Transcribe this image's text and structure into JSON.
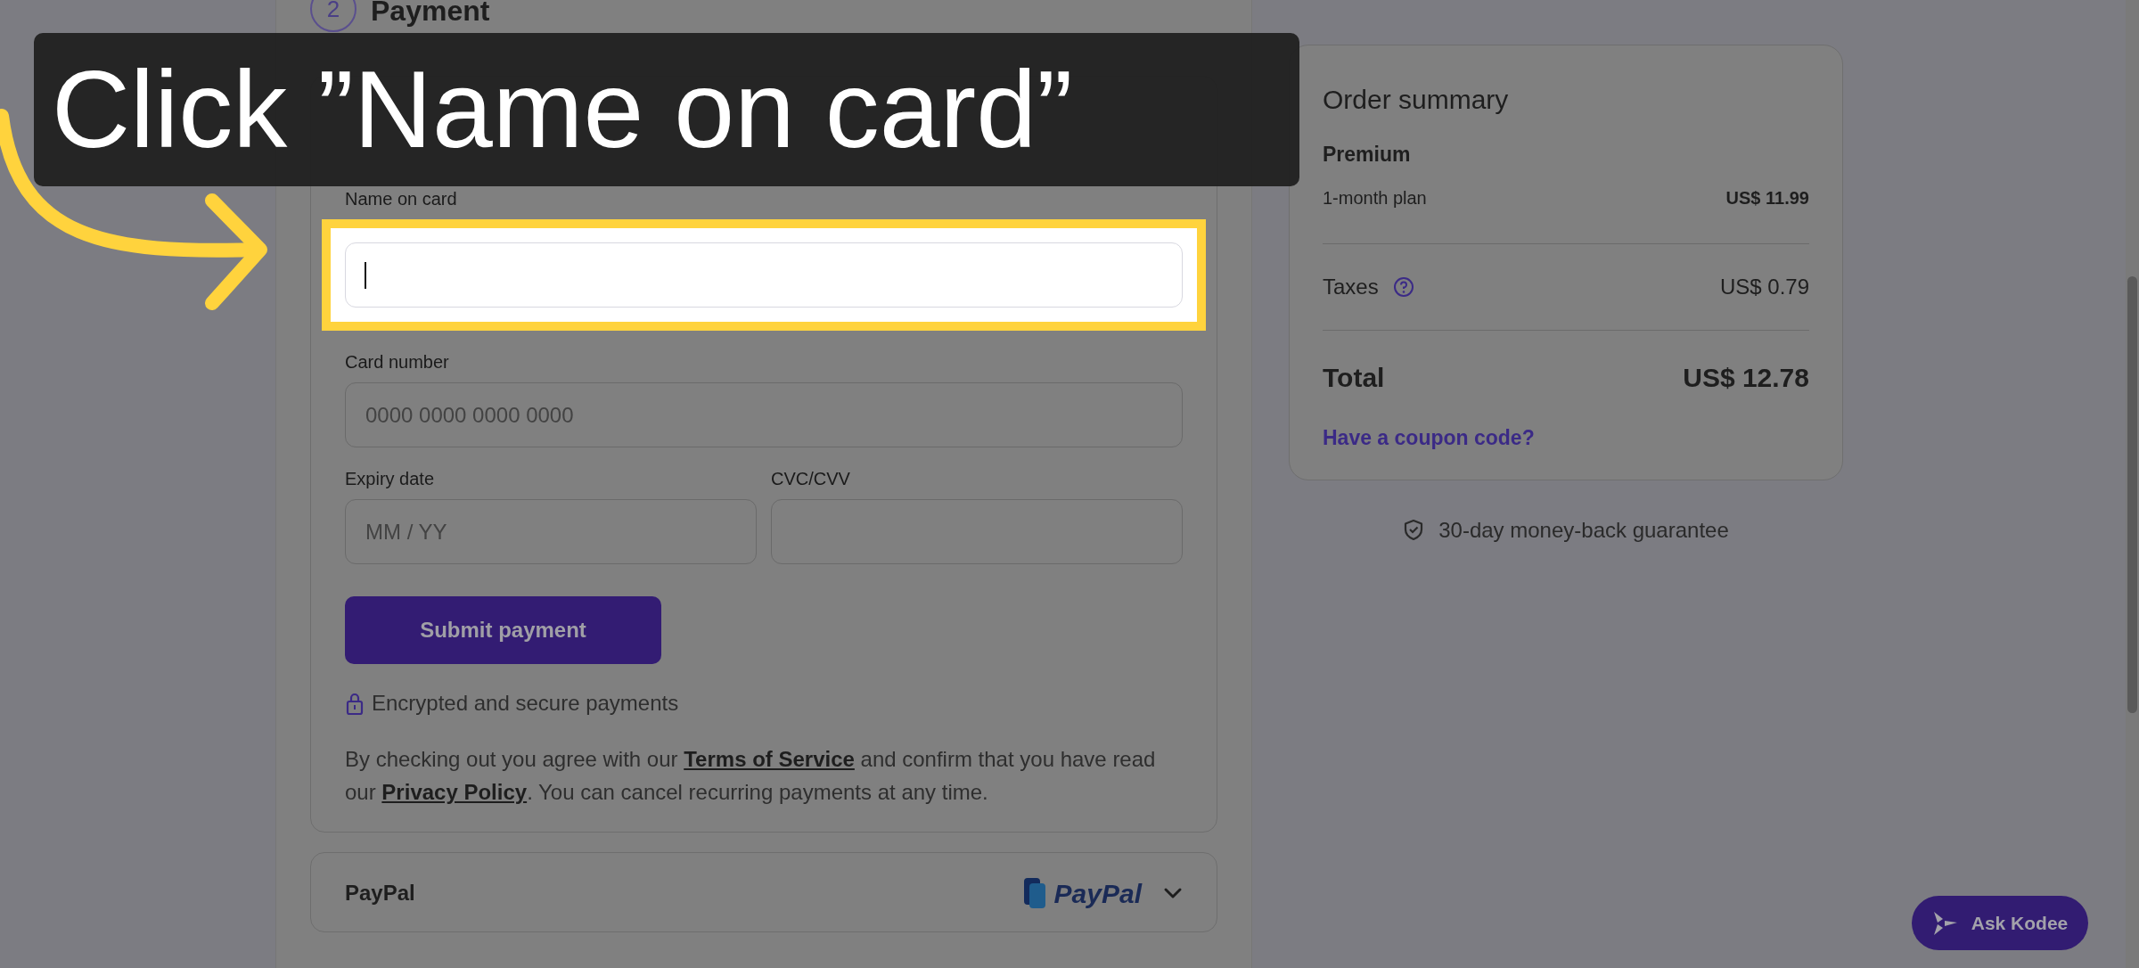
{
  "tutorial": {
    "callout": "Click ”Name on card”"
  },
  "step": {
    "number": "2",
    "title": "Payment"
  },
  "payment_methods": [
    {
      "kind": "card",
      "expanded": true,
      "name_field": {
        "label": "Name on card",
        "highlighted": true,
        "focused": true
      },
      "number_field": {
        "label": "Card number",
        "placeholder": "0000 0000 0000 0000"
      },
      "split_fields": [
        {
          "label": "Expiry date",
          "placeholder": "MM / YY"
        },
        {
          "label": "CVC/CVV"
        }
      ],
      "submit_button": "Submit payment",
      "secure_note": "Encrypted and secure payments",
      "terms": [
        {
          "kind": "text",
          "text": "By checking out you agree with our "
        },
        {
          "kind": "link",
          "text": "Terms of Service"
        },
        {
          "kind": "text",
          "text": " and confirm that you have read our "
        },
        {
          "kind": "link",
          "text": "Privacy Policy"
        },
        {
          "kind": "text",
          "text": ". You can cancel recurring payments at any time."
        }
      ]
    },
    {
      "kind": "paypal",
      "label": "PayPal",
      "logo_text": "PayPal",
      "expanded": false
    }
  ],
  "order_summary": {
    "title": "Order summary",
    "plan": "Premium",
    "items": [
      {
        "kind": "plan",
        "label": "1-month plan",
        "amount": "US$ 11.99",
        "info": false
      },
      {
        "kind": "tax",
        "label": "Taxes",
        "amount": "US$ 0.79",
        "info": true
      }
    ],
    "total_label": "Total",
    "total": "US$ 12.78",
    "coupon_link": "Have a coupon code?"
  },
  "guarantee": "30-day money-back guarantee",
  "assistant_button": "Ask Kodee"
}
